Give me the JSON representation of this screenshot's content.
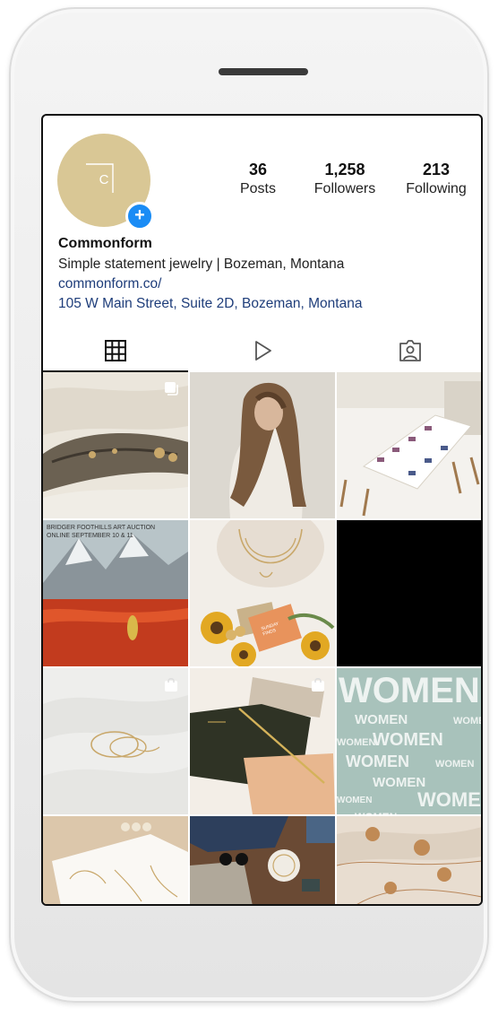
{
  "profile": {
    "avatar_letter": "C",
    "username": "Commonform",
    "bio": "Simple statement jewelry | Bozeman, Montana",
    "website": "commonform.co/",
    "address": "105 W Main Street, Suite 2D, Bozeman, Montana"
  },
  "stats": {
    "posts_count": "36",
    "posts_label": "Posts",
    "followers_count": "1,258",
    "followers_label": "Followers",
    "following_count": "213",
    "following_label": "Following"
  },
  "tabs": [
    {
      "icon": "grid-icon",
      "active": true
    },
    {
      "icon": "reels-play-icon",
      "active": false
    },
    {
      "icon": "tagged-person-icon",
      "active": false
    }
  ],
  "posts": {
    "poster_text": "BRIDGER FOOTHILLS ART AUCTION\nONLINE SEPTEMBER 10 & 11",
    "women_line1": "WOMEN",
    "women_rows": [
      "WOMEN",
      "WOMEN",
      "WOMEN",
      "WOMEN",
      "WOMEN",
      "WOMEN",
      "WOMEN",
      "WOMEN",
      "WOMEN",
      "WOMEN"
    ],
    "card_text": "SUNDAY\nFINDS"
  },
  "colors": {
    "avatar": "#d9c795",
    "link": "#1e3d7a",
    "plus_badge": "#1a8cf5",
    "women_tile": "#a8c2bb"
  }
}
